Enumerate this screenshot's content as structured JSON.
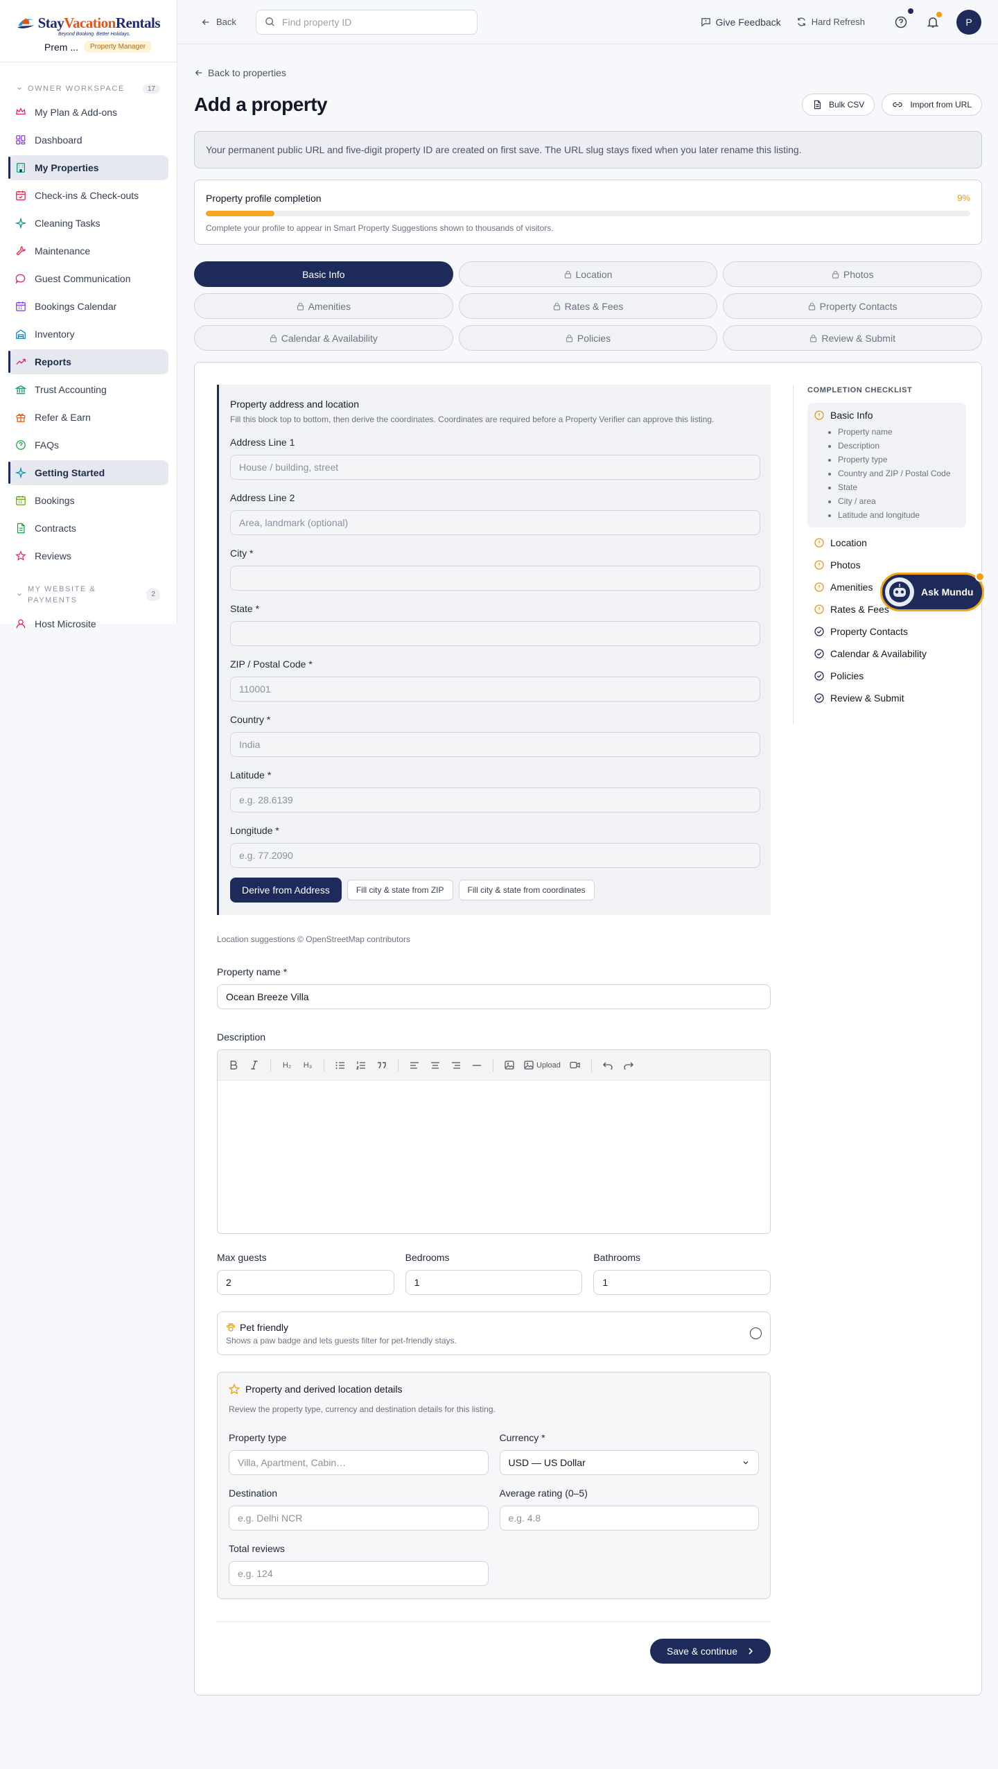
{
  "brand": {
    "name_a": "Stay",
    "name_b": "Vacation",
    "name_c": "Rentals",
    "tagline": "Beyond Booking. Better Holidays."
  },
  "user": {
    "name": "Prem ...",
    "role": "Property Manager",
    "initial": "P"
  },
  "sidebar": {
    "section1": {
      "title": "OWNER WORKSPACE",
      "count": "17"
    },
    "items": [
      {
        "label": "My Plan & Add-ons",
        "icon": "crown-icon",
        "color": "#e11d74"
      },
      {
        "label": "Dashboard",
        "icon": "grid-icon",
        "color": "#7c3aed"
      },
      {
        "label": "My Properties",
        "icon": "building-icon",
        "color": "#0d9488",
        "active": true
      },
      {
        "label": "Check-ins & Check-outs",
        "icon": "calendar-check-icon",
        "color": "#e11d48"
      },
      {
        "label": "Cleaning Tasks",
        "icon": "sparkle-icon",
        "color": "#0d9488"
      },
      {
        "label": "Maintenance",
        "icon": "wrench-icon",
        "color": "#e11d48"
      },
      {
        "label": "Guest Communication",
        "icon": "chat-icon",
        "color": "#e11d48"
      },
      {
        "label": "Bookings Calendar",
        "icon": "calendar-icon",
        "color": "#7c3aed"
      },
      {
        "label": "Inventory",
        "icon": "warehouse-icon",
        "color": "#0284c7"
      },
      {
        "label": "Reports",
        "icon": "trend-icon",
        "color": "#db2777",
        "active": true
      },
      {
        "label": "Trust Accounting",
        "icon": "bank-icon",
        "color": "#059669"
      },
      {
        "label": "Refer & Earn",
        "icon": "gift-icon",
        "color": "#ea580c"
      },
      {
        "label": "FAQs",
        "icon": "help-icon",
        "color": "#16a34a"
      },
      {
        "label": "Getting Started",
        "icon": "sparkle-icon",
        "color": "#0891b2",
        "active": true
      },
      {
        "label": "Bookings",
        "icon": "calendar-icon",
        "color": "#65a30d"
      },
      {
        "label": "Contracts",
        "icon": "file-icon",
        "color": "#16a34a"
      },
      {
        "label": "Reviews",
        "icon": "star-icon",
        "color": "#db2777"
      }
    ],
    "section2": {
      "title_line1": "MY WEBSITE &",
      "title_line2": "PAYMENTS",
      "count": "2"
    },
    "items2": [
      {
        "label": "Host Microsite",
        "icon": "user-icon",
        "color": "#e11d48"
      }
    ]
  },
  "topbar": {
    "back_label": "Back",
    "search_placeholder": "Find property ID",
    "feedback_label": "Give Feedback",
    "refresh_label": "Hard Refresh"
  },
  "page": {
    "back_link": "Back to properties",
    "title": "Add a property",
    "bulk_csv": "Bulk CSV",
    "import_url": "Import from URL",
    "notice": "Your permanent public URL and five-digit property ID are created on first save. The URL slug stays fixed when you later rename this listing.",
    "progress": {
      "label": "Profile completion",
      "label_prefix": "Property profile completion",
      "percent_text": "9%",
      "value": 0.09,
      "hint": "Complete your profile to appear in Smart Property Suggestions shown to thousands of visitors."
    }
  },
  "tabs": [
    "Basic Info",
    "Location",
    "Photos",
    "Amenities",
    "Rates & Fees",
    "Property Contacts",
    "Calendar & Availability",
    "Policies",
    "Review & Submit"
  ],
  "address": {
    "title": "Property address and location",
    "subtitle": "Fill this block top to bottom, then derive the coordinates. Coordinates are required before a Property Verifier can approve this listing.",
    "fields": [
      {
        "label": "Address Line 1",
        "value": "",
        "placeholder": "House / building, street"
      },
      {
        "label": "Address Line 2",
        "value": "",
        "placeholder": "Area, landmark (optional)"
      },
      {
        "label": "City *",
        "value": "",
        "placeholder": ""
      },
      {
        "label": "State *",
        "value": "",
        "placeholder": ""
      },
      {
        "label": "ZIP / Postal Code *",
        "value": "",
        "placeholder": "110001"
      },
      {
        "label": "Country *",
        "value": "",
        "placeholder": "India"
      },
      {
        "label": "Latitude *",
        "value": "",
        "placeholder": "e.g. 28.6139"
      },
      {
        "label": "Longitude *",
        "value": "",
        "placeholder": "e.g. 77.2090"
      }
    ],
    "derive_btn": "Derive from Address",
    "zip_btn": "Fill city & state from ZIP",
    "coords_btn": "Fill city & state from coordinates",
    "osm": "Location suggestions © OpenStreetMap contributors"
  },
  "basic": {
    "name_label": "Property name *",
    "name_value": "Ocean Breeze Villa",
    "desc_label": "Description",
    "upload_label": "Upload",
    "guests_label": "Max guests",
    "guests_value": "2",
    "bedrooms_label": "Bedrooms",
    "bedrooms_value": "1",
    "bathrooms_label": "Bathrooms",
    "bathrooms_value": "1",
    "pet_title": "Pet friendly",
    "pet_sub": "Shows a paw badge and lets guests filter for pet-friendly stays."
  },
  "derived": {
    "title": "Property and derived location details",
    "subtitle": "Review the property type, currency and destination details for this listing.",
    "type_label": "Property type",
    "type_placeholder": "Villa, Apartment, Cabin…",
    "currency_label": "Currency *",
    "currency_value": "USD — US Dollar",
    "dest_label": "Destination",
    "dest_placeholder": "e.g. Delhi NCR",
    "rating_label": "Average rating (0–5)",
    "rating_placeholder": "e.g. 4.8",
    "reviews_label": "Total reviews",
    "reviews_placeholder": "e.g. 124"
  },
  "save_label": "Save & continue",
  "checklist": {
    "title": "COMPLETION CHECKLIST",
    "active": "Basic Info",
    "subitems": [
      "Property name",
      "Description",
      "Property type",
      "Country and ZIP / Postal Code",
      "State",
      "City / area",
      "Latitude and longitude"
    ],
    "items": [
      {
        "label": "Location",
        "state": "warn"
      },
      {
        "label": "Photos",
        "state": "warn"
      },
      {
        "label": "Amenities",
        "state": "warn"
      },
      {
        "label": "Rates & Fees",
        "state": "warn"
      },
      {
        "label": "Property Contacts",
        "state": "done"
      },
      {
        "label": "Calendar & Availability",
        "state": "done"
      },
      {
        "label": "Policies",
        "state": "done"
      },
      {
        "label": "Review & Submit",
        "state": "done"
      }
    ]
  },
  "mundu_label": "Ask Mundu",
  "colors": {
    "accent": "#1e2a5a",
    "warning": "#f5a623"
  }
}
